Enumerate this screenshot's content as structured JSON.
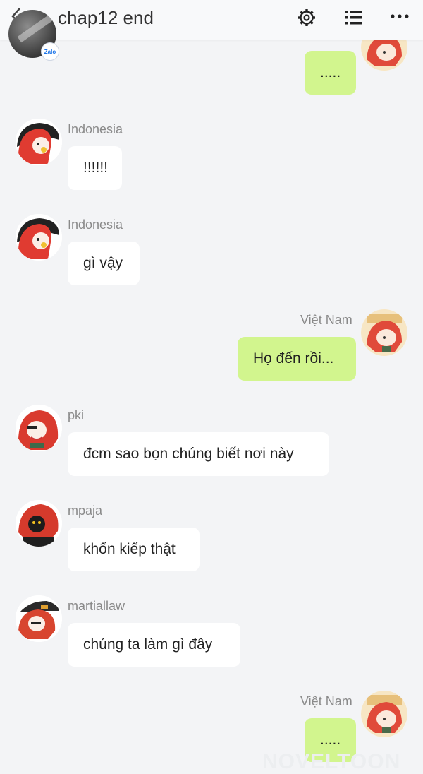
{
  "header": {
    "title": "chap12 end",
    "group_badge": "Zalo"
  },
  "colors": {
    "own_bubble": "#d2f58e",
    "other_bubble": "#ffffff",
    "sender_name": "#8a8a8a",
    "background": "#f3f4f6"
  },
  "icons": {
    "back": "back-arrow-icon",
    "settings": "gear-icon",
    "list": "list-icon",
    "more": "more-dots-icon"
  },
  "messages": [
    {
      "side": "right",
      "sender": "",
      "text": "....."
    },
    {
      "side": "left",
      "sender": "Indonesia",
      "text": "!!!!!!"
    },
    {
      "side": "left",
      "sender": "Indonesia",
      "text": "gì vậy"
    },
    {
      "side": "right",
      "sender": "Việt Nam",
      "text": "Họ đến rồi..."
    },
    {
      "side": "left",
      "sender": "pki",
      "text": "đcm sao bọn chúng biết nơi này"
    },
    {
      "side": "left",
      "sender": "mpaja",
      "text": "khốn kiếp thật"
    },
    {
      "side": "left",
      "sender": "martiallaw",
      "text": "chúng ta làm gì đây"
    },
    {
      "side": "right",
      "sender": "Việt Nam",
      "text": "....."
    }
  ],
  "watermark": "NOVELTOON"
}
